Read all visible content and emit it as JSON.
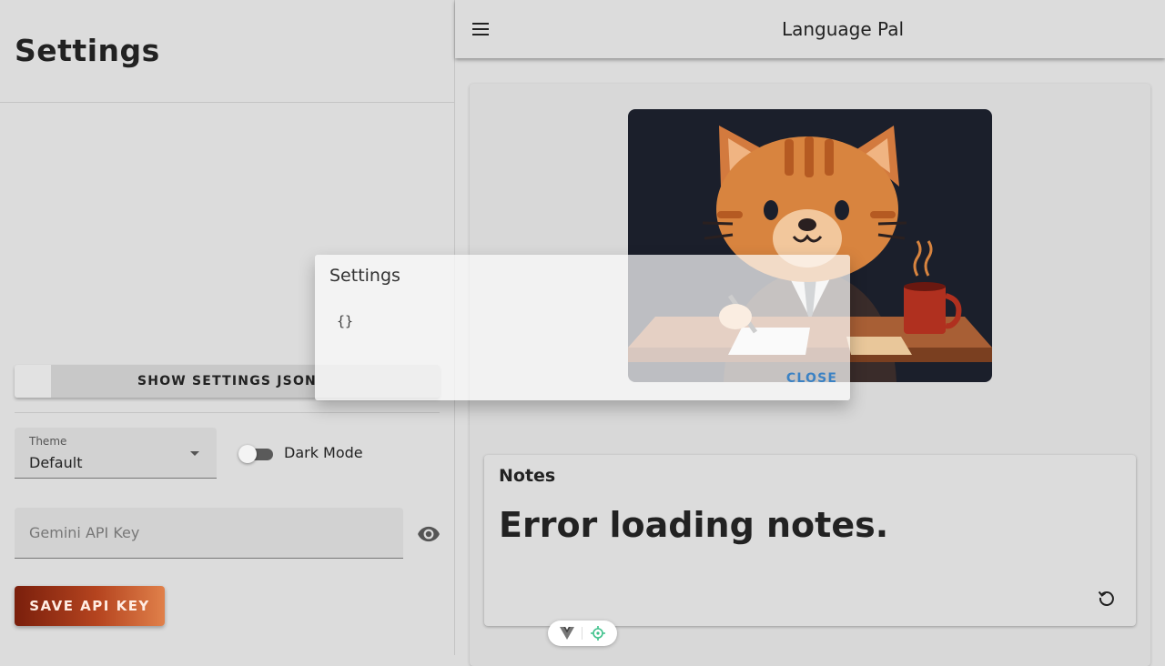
{
  "drawer": {
    "title": "Settings",
    "show_json_label": "SHOW SETTINGS JSON",
    "theme": {
      "label": "Theme",
      "value": "Default"
    },
    "dark_mode": {
      "label": "Dark Mode",
      "enabled": false
    },
    "api_key": {
      "placeholder": "Gemini API Key",
      "value": ""
    },
    "save_label": "SAVE API KEY"
  },
  "header": {
    "title": "Language Pal",
    "menu_icon": "menu-icon"
  },
  "notes": {
    "title": "Notes",
    "message": "Error loading notes.",
    "refresh_icon": "refresh-icon"
  },
  "modal": {
    "title": "Settings",
    "json_text": "{}",
    "close_label": "CLOSE"
  },
  "devtools": {
    "icons": [
      "vue-icon",
      "target-icon"
    ]
  },
  "colors": {
    "accent_blue": "#3b82c4",
    "save_gradient_start": "#7a1f0c",
    "save_gradient_end": "#e0804a",
    "cat_background": "#1b1f2b"
  }
}
